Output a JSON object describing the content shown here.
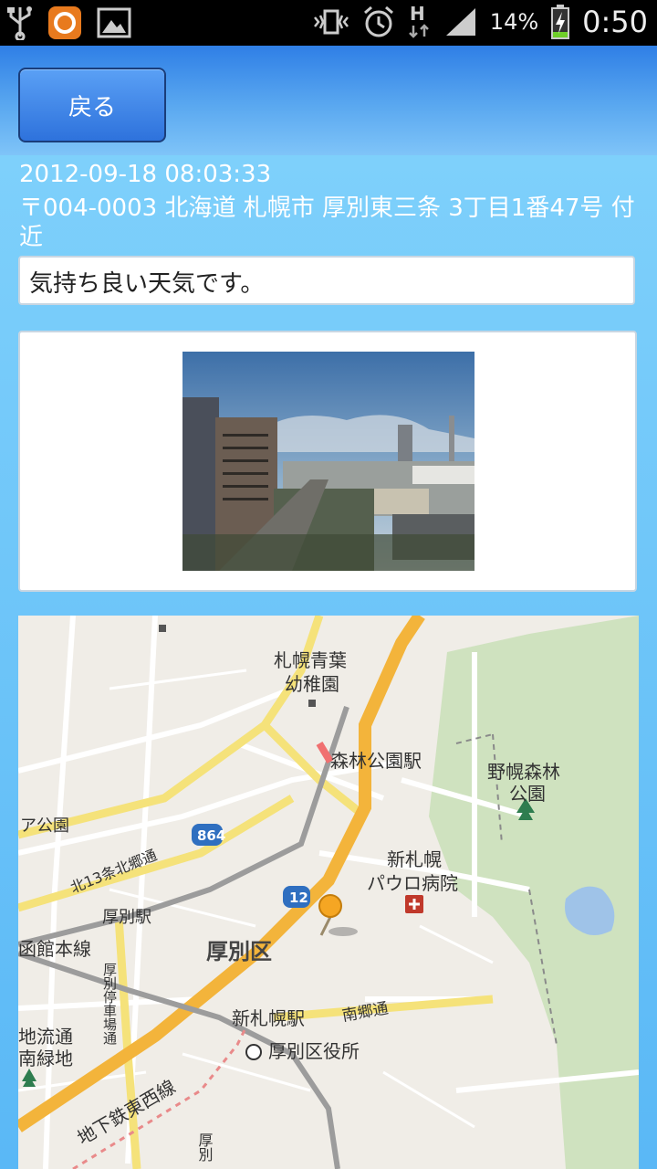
{
  "status_bar": {
    "icons_left": [
      "usb-icon",
      "app-icon",
      "image-icon"
    ],
    "icons_right": [
      "vibrate-icon",
      "alarm-icon",
      "hspa-icon",
      "signal-icon"
    ],
    "battery_percent": "14%",
    "time": "0:50"
  },
  "header": {
    "back_label": "戻る"
  },
  "post": {
    "datetime": "2012-09-18 08:03:33",
    "address": "〒004-0003 北海道 札幌市 厚別東三条 3丁目1番47号 付近",
    "comment": "気持ち良い天気です。"
  },
  "map": {
    "labels": {
      "kindergarten": "札幌青葉\n幼稚園",
      "shinrin_koen_station": "森林公園駅",
      "nopporo_park": "野幌森林\n公園",
      "park_left": "公園",
      "route_864": "864",
      "kita13jo": "北13条北郷通",
      "shin_sapporo_hospital": "新札幌\nパウロ病院",
      "route_12": "12",
      "atsubetsu_station": "厚別駅",
      "hakodate_line": "函館本線",
      "ward": "厚別区",
      "atsubetsu_teishajo": "厚別停車場通",
      "shin_sapporo_station": "新札幌駅",
      "nangodori": "南郷通",
      "chiryu": "地流通",
      "minami_ryokuchi": "南緑地",
      "ward_office": "厚別区役所",
      "tozai_line": "地下鉄東西線",
      "atsubetsu_bottom": "厚別"
    }
  }
}
